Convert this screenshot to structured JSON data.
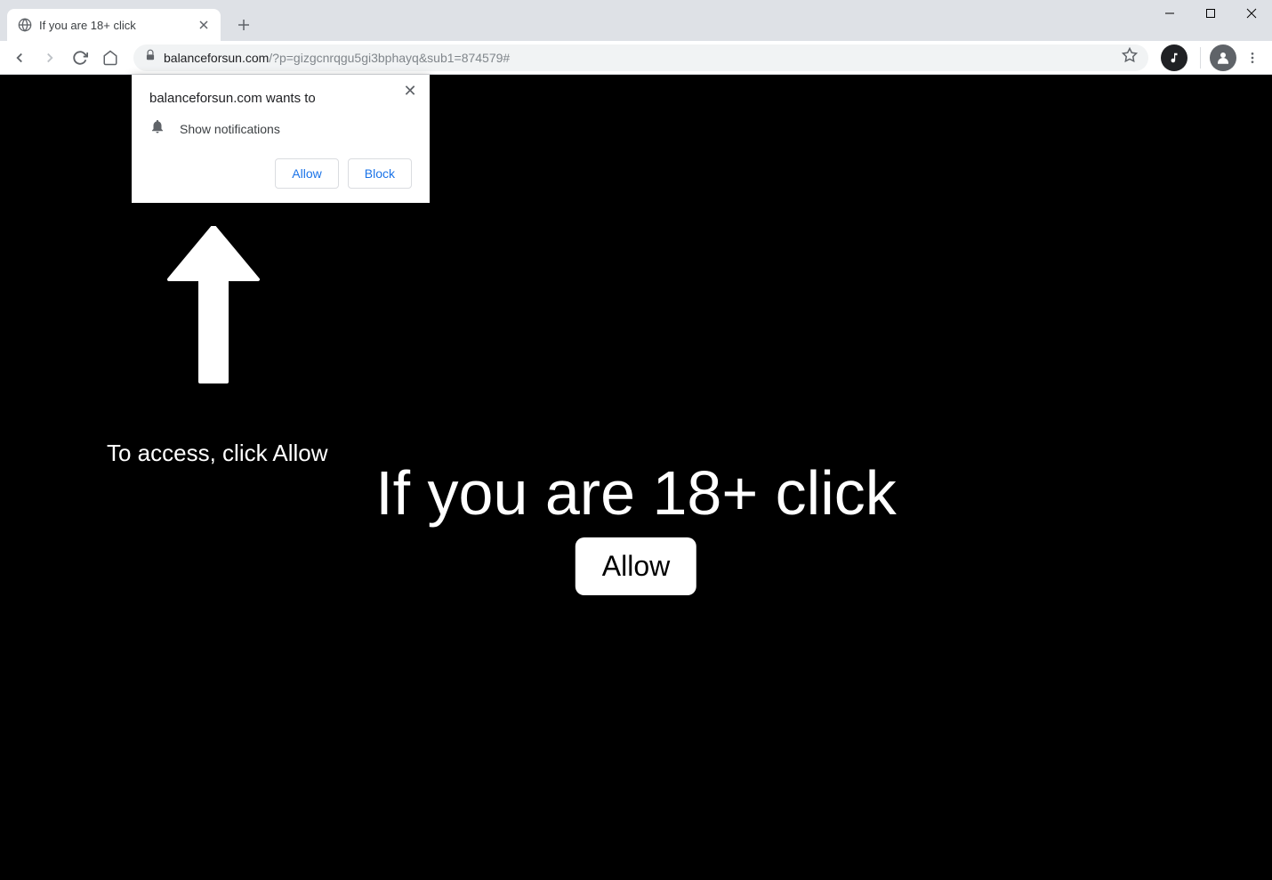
{
  "window": {
    "tab_title": "If you are 18+ click"
  },
  "toolbar": {
    "url_domain": "balanceforsun.com",
    "url_path": "/?p=gizgcnrqgu5gi3bphayq&sub1=874579#"
  },
  "permission_prompt": {
    "origin_text": "balanceforsun.com wants to",
    "permission_label": "Show notifications",
    "allow_label": "Allow",
    "block_label": "Block"
  },
  "page": {
    "access_text": "To access, click Allow",
    "heading": "If you are 18+ click",
    "allow_button": "Allow"
  }
}
